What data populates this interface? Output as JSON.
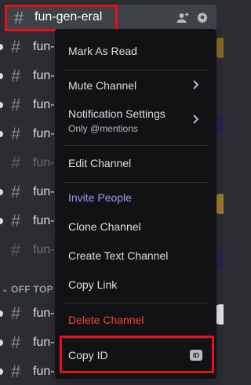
{
  "active_channel": {
    "name": "fun-gen-eral"
  },
  "channels": [
    {
      "name": "fun-"
    },
    {
      "name": "fun-"
    },
    {
      "name": "fun-"
    },
    {
      "name": "fun-"
    },
    {
      "name": "fun-"
    },
    {
      "name": "fun-"
    },
    {
      "name": "fun-"
    },
    {
      "name": "fun-"
    }
  ],
  "category": {
    "label": "OFF TOP"
  },
  "bottom_channels": [
    {
      "name": "fun-"
    },
    {
      "name": "fun-"
    },
    {
      "name": "fun-automotive-engineer"
    }
  ],
  "context_menu": {
    "mark_as_read": "Mark As Read",
    "mute_channel": "Mute Channel",
    "notification_settings": "Notification Settings",
    "notification_sub": "Only @mentions",
    "edit_channel": "Edit Channel",
    "invite_people": "Invite People",
    "clone_channel": "Clone Channel",
    "create_text_channel": "Create Text Channel",
    "copy_link": "Copy Link",
    "delete_channel": "Delete Channel",
    "copy_id": "Copy ID",
    "id_badge": "ID"
  },
  "colors": {
    "background": "#2b2d31",
    "menu_bg": "#111214",
    "highlight_box": "#e8101b",
    "blurple": "#949cf7",
    "danger": "#f23f42"
  }
}
